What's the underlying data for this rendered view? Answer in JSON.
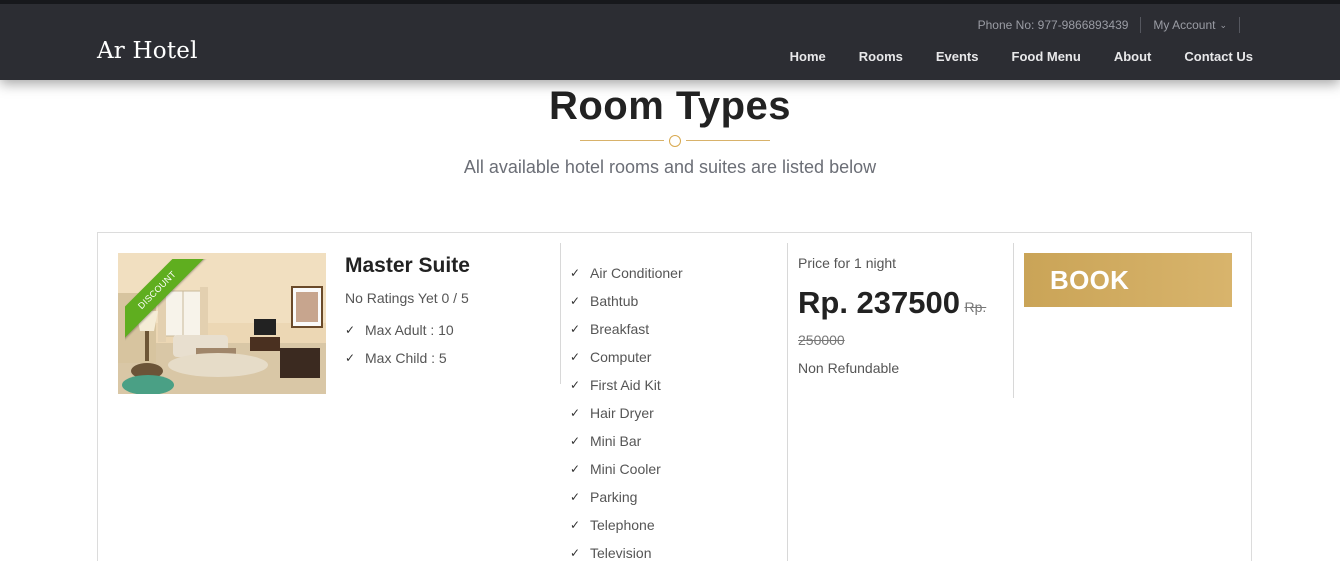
{
  "header": {
    "logo": "Ar Hotel",
    "phone": "Phone No: 977-9866893439",
    "account": "My Account",
    "nav": [
      "Home",
      "Rooms",
      "Events",
      "Food Menu",
      "About",
      "Contact Us"
    ]
  },
  "hero": {
    "title": "Room Types",
    "subtitle": "All available hotel rooms and suites are listed below"
  },
  "room": {
    "badge": "DISCOUNT",
    "name": "Master Suite",
    "rating": "No Ratings Yet 0 / 5",
    "max_adult": "Max Adult : 10",
    "max_child": "Max Child : 5",
    "amenities": [
      "Air Conditioner",
      "Bathtub",
      "Breakfast",
      "Computer",
      "First Aid Kit",
      "Hair Dryer",
      "Mini Bar",
      "Mini Cooler",
      "Parking",
      "Telephone",
      "Television"
    ],
    "price_label": "Price for 1 night",
    "price": "Rp. 237500",
    "old_price": "Rp. 250000",
    "refund": "Non Refundable",
    "book_label": "BOOK"
  },
  "colors": {
    "header_bg": "#2c2d33",
    "accent_gold": "#d0aa5e",
    "ribbon_green": "#5fae1f"
  }
}
